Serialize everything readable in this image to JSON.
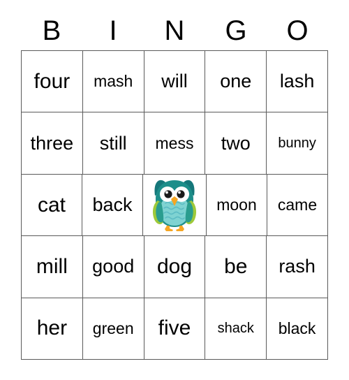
{
  "header": {
    "letters": [
      "B",
      "I",
      "N",
      "G",
      "O"
    ]
  },
  "grid": {
    "columns": 5,
    "rows": 5,
    "cells": [
      [
        {
          "text": "four",
          "size": "xl"
        },
        {
          "text": "mash",
          "size": "md"
        },
        {
          "text": "will",
          "size": "lg"
        },
        {
          "text": "one",
          "size": "lg"
        },
        {
          "text": "lash",
          "size": "lg"
        }
      ],
      [
        {
          "text": "three",
          "size": "lg"
        },
        {
          "text": "still",
          "size": "lg"
        },
        {
          "text": "mess",
          "size": "md"
        },
        {
          "text": "two",
          "size": "lg"
        },
        {
          "text": "bunny",
          "size": "sm"
        }
      ],
      [
        {
          "text": "cat",
          "size": "xl"
        },
        {
          "text": "back",
          "size": "lg"
        },
        {
          "text": "",
          "size": "lg",
          "free_space": true,
          "icon": "owl-icon"
        },
        {
          "text": "moon",
          "size": "md"
        },
        {
          "text": "came",
          "size": "md"
        }
      ],
      [
        {
          "text": "mill",
          "size": "xl"
        },
        {
          "text": "good",
          "size": "lg"
        },
        {
          "text": "dog",
          "size": "xl"
        },
        {
          "text": "be",
          "size": "xl"
        },
        {
          "text": "rash",
          "size": "lg"
        }
      ],
      [
        {
          "text": "her",
          "size": "xl"
        },
        {
          "text": "green",
          "size": "md"
        },
        {
          "text": "five",
          "size": "xl"
        },
        {
          "text": "shack",
          "size": "sm"
        },
        {
          "text": "black",
          "size": "md"
        }
      ]
    ]
  },
  "colors": {
    "border": "#5a5a5a",
    "text": "#000000",
    "background": "#ffffff",
    "owl_head": "#1d8e8a",
    "owl_head_dark": "#15777a",
    "owl_belly": "#7fd3d2",
    "owl_belly_line": "#5dbcc4",
    "owl_wing_green": "#9ec93a",
    "owl_wing_teal": "#2a9d8f",
    "owl_beak": "#f5a623",
    "owl_feet": "#f5a623",
    "owl_eye_white": "#ffffff",
    "owl_pupil": "#1a1a1a"
  }
}
